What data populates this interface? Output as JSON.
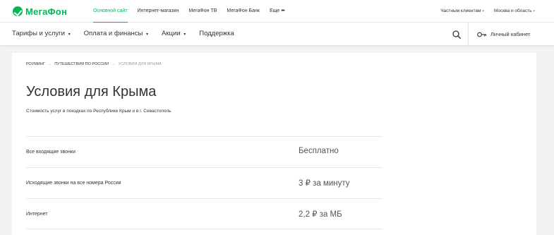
{
  "brand": {
    "name": "МегаФон",
    "color": "#00b956"
  },
  "topnav": {
    "items": [
      {
        "label": "Основной сайт",
        "active": true
      },
      {
        "label": "Интернет-магазин"
      },
      {
        "label": "МегаФон ТВ"
      },
      {
        "label": "МегаФон Банк"
      }
    ],
    "more_label": "Еще",
    "more_dots": "•••"
  },
  "topright": {
    "segment": "Частным клиентам",
    "region": "Москва и область"
  },
  "mainnav": {
    "items": [
      {
        "label": "Тарифы и услуги",
        "has_caret": true
      },
      {
        "label": "Оплата и финансы",
        "has_caret": true
      },
      {
        "label": "Акции",
        "has_caret": true
      },
      {
        "label": "Поддержка",
        "has_caret": false
      }
    ],
    "caret": "▾"
  },
  "header_actions": {
    "search_icon": "search-icon",
    "cabinet_icon": "key-icon",
    "cabinet_label": "Личный кабинет"
  },
  "breadcrumb": {
    "items": [
      "Роуминг",
      "Путешествия по России",
      "Условия для Крыма"
    ],
    "separator": "→"
  },
  "page": {
    "title": "Условия для Крыма",
    "subtitle": "Стоимость услуг в поездках по Республике Крым и в г. Севастополь"
  },
  "rates": [
    {
      "label": "Все входящие звонки",
      "value": "Бесплатно"
    },
    {
      "label": "Исходящие звонки на все номера России",
      "value": "3 ₽ за минуту"
    },
    {
      "label": "Интернет",
      "value": "2,2 ₽ за МБ"
    }
  ]
}
